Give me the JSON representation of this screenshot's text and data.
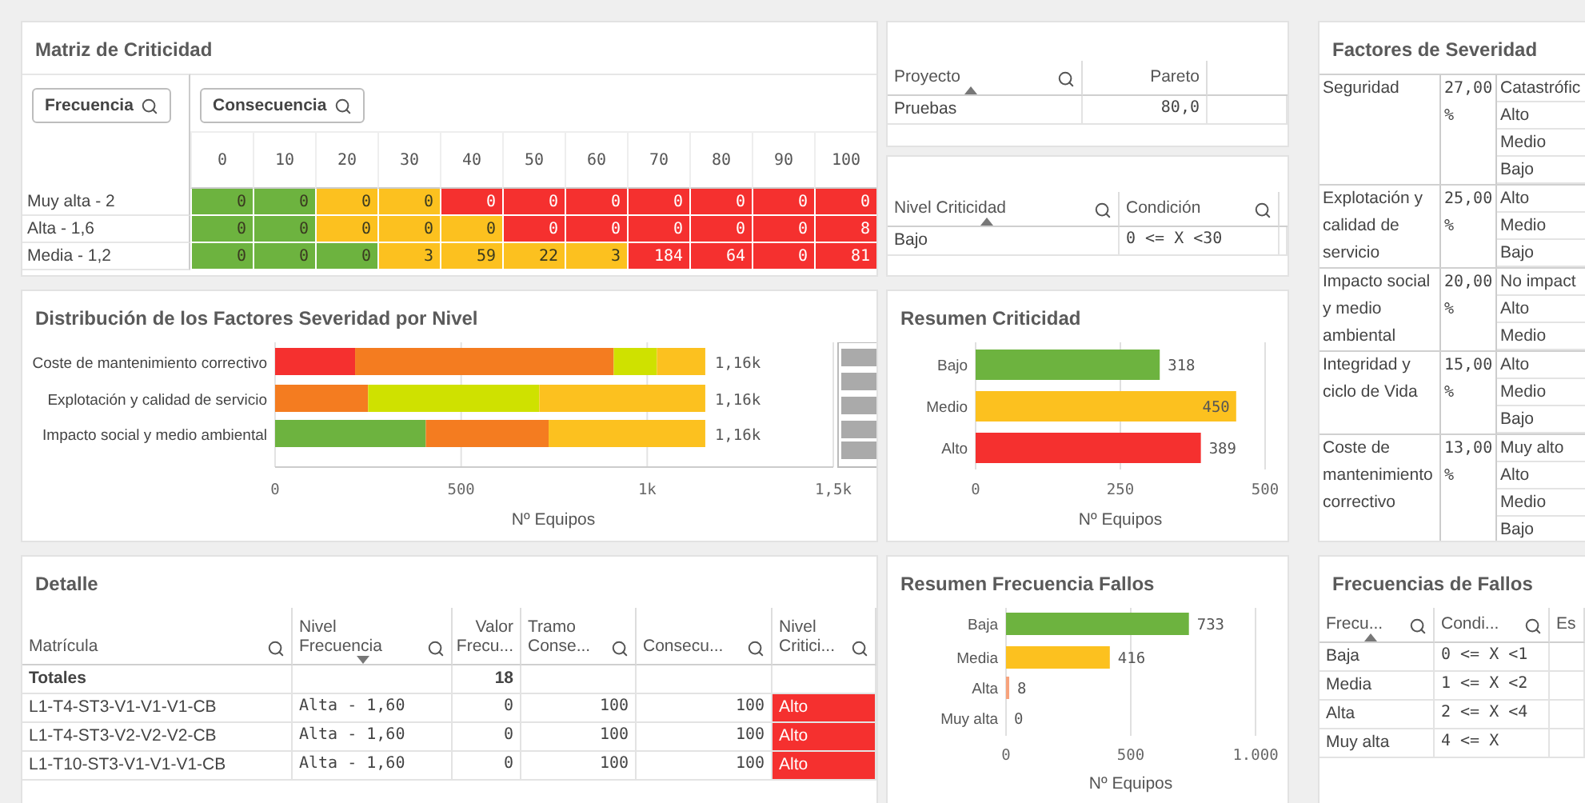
{
  "matrix": {
    "title": "Matriz de Criticidad",
    "row_filter": "Frecuencia",
    "column_filter": "Consecuencia",
    "columns": [
      "0",
      "10",
      "20",
      "30",
      "40",
      "50",
      "60",
      "70",
      "80",
      "90",
      "100"
    ],
    "rows": [
      {
        "label": "Muy alta - 2",
        "cells": [
          {
            "value": "0",
            "color": "#6db33f"
          },
          {
            "value": "0",
            "color": "#6db33f"
          },
          {
            "value": "0",
            "color": "#fcc11f"
          },
          {
            "value": "0",
            "color": "#fcc11f"
          },
          {
            "value": "0",
            "color": "#f5302f"
          },
          {
            "value": "0",
            "color": "#f5302f"
          },
          {
            "value": "0",
            "color": "#f5302f"
          },
          {
            "value": "0",
            "color": "#f5302f"
          },
          {
            "value": "0",
            "color": "#f5302f"
          },
          {
            "value": "0",
            "color": "#f5302f"
          },
          {
            "value": "0",
            "color": "#f5302f"
          }
        ]
      },
      {
        "label": "Alta - 1,6",
        "cells": [
          {
            "value": "0",
            "color": "#6db33f"
          },
          {
            "value": "0",
            "color": "#6db33f"
          },
          {
            "value": "0",
            "color": "#fcc11f"
          },
          {
            "value": "0",
            "color": "#fcc11f"
          },
          {
            "value": "0",
            "color": "#fcc11f"
          },
          {
            "value": "0",
            "color": "#f5302f"
          },
          {
            "value": "0",
            "color": "#f5302f"
          },
          {
            "value": "0",
            "color": "#f5302f"
          },
          {
            "value": "0",
            "color": "#f5302f"
          },
          {
            "value": "0",
            "color": "#f5302f"
          },
          {
            "value": "8",
            "color": "#f5302f"
          }
        ]
      },
      {
        "label": "Media - 1,2",
        "cells": [
          {
            "value": "0",
            "color": "#6db33f"
          },
          {
            "value": "0",
            "color": "#6db33f"
          },
          {
            "value": "0",
            "color": "#6db33f"
          },
          {
            "value": "3",
            "color": "#fcc11f"
          },
          {
            "value": "59",
            "color": "#fcc11f"
          },
          {
            "value": "22",
            "color": "#fcc11f"
          },
          {
            "value": "3",
            "color": "#fcc11f"
          },
          {
            "value": "184",
            "color": "#f5302f"
          },
          {
            "value": "64",
            "color": "#f5302f"
          },
          {
            "value": "0",
            "color": "#f5302f"
          },
          {
            "value": "81",
            "color": "#f5302f"
          }
        ]
      }
    ]
  },
  "project_table": {
    "columns": [
      {
        "label": "Proyecto",
        "search": true,
        "sorted": true,
        "descending": false
      },
      {
        "label": "Pareto",
        "search": false,
        "sorted": false
      }
    ],
    "rows": [
      [
        "Pruebas",
        "80,0"
      ]
    ]
  },
  "criticity_table": {
    "columns": [
      {
        "label": "Nivel Criticidad",
        "search": true,
        "sorted": true,
        "descending": false
      },
      {
        "label": "Condición",
        "search": true,
        "sorted": false
      }
    ],
    "rows": [
      [
        "Bajo",
        "0 <= X <30"
      ]
    ]
  },
  "severity_factors": {
    "title": "Factores de Severidad",
    "groups": [
      {
        "factor": "Seguridad",
        "weight": "27,00 %",
        "levels": [
          "Catastrófic",
          "Alto",
          "Medio",
          "Bajo"
        ]
      },
      {
        "factor": "Explotación y calidad de servicio",
        "weight": "25,00 %",
        "levels": [
          "Alto",
          "Medio",
          "Bajo"
        ]
      },
      {
        "factor": "Impacto social y medio ambiental",
        "weight": "20,00 %",
        "levels": [
          "No impact",
          "Alto",
          "Medio"
        ]
      },
      {
        "factor": "Integridad y ciclo de Vida",
        "weight": "15,00 %",
        "levels": [
          "Alto",
          "Medio",
          "Bajo"
        ]
      },
      {
        "factor": "Coste de mantenimiento correctivo",
        "weight": "13,00 %",
        "levels": [
          "Muy alto",
          "Alto",
          "Medio",
          "Bajo"
        ]
      }
    ]
  },
  "distribution": {
    "title": "Distribución de los Factores Severidad por Nivel",
    "chart_data": {
      "type": "bar",
      "orientation": "horizontal",
      "stacked": true,
      "xlabel": "Nº Equipos",
      "categories": [
        "Coste de mantenimiento correctivo",
        "Explotación y calidad de servicio",
        "Impacto social y medio ambiental"
      ],
      "series": [
        {
          "color": "#f5302f",
          "values": [
            215,
            0,
            0
          ]
        },
        {
          "color": "#6db33f",
          "values": [
            0,
            0,
            405
          ]
        },
        {
          "color": "#f47c20",
          "values": [
            695,
            250,
            330
          ]
        },
        {
          "color": "#cfe100",
          "values": [
            116,
            460,
            0
          ]
        },
        {
          "color": "#fcc11f",
          "values": [
            130,
            446,
            421
          ]
        }
      ],
      "xlim": [
        0,
        1500
      ],
      "xticks": [
        0,
        500,
        {
          "value": 1000,
          "label": "1k"
        },
        {
          "value": 1500,
          "label": "1,5k"
        }
      ],
      "value_labels": [
        "1,16k",
        "1,16k",
        "1,16k"
      ]
    }
  },
  "criticity_summary": {
    "title": "Resumen Criticidad",
    "chart_data": {
      "type": "bar",
      "orientation": "horizontal",
      "xlabel": "Nº Equipos",
      "categories": [
        "Bajo",
        "Medio",
        "Alto"
      ],
      "series": [
        {
          "values": [
            318,
            450,
            389
          ]
        }
      ],
      "colors": [
        "#6db33f",
        "#fcc11f",
        "#f5302f"
      ],
      "xlim": [
        0,
        500
      ],
      "xticks": [
        0,
        250,
        500
      ],
      "data_labels": true
    }
  },
  "frequency_summary": {
    "title": "Resumen Frecuencia Fallos",
    "chart_data": {
      "type": "bar",
      "orientation": "horizontal",
      "xlabel": "Nº Equipos",
      "categories": [
        "Baja",
        "Media",
        "Alta",
        "Muy alta"
      ],
      "series": [
        {
          "values": [
            733,
            416,
            8,
            0
          ]
        }
      ],
      "colors": [
        "#6db33f",
        "#fcc11f",
        "#f7a27c"
      ],
      "xlim": [
        0,
        1000
      ],
      "xticks": [
        0,
        500,
        {
          "value": 1000,
          "label": "1.000"
        }
      ],
      "data_labels": true
    }
  },
  "detail": {
    "title": "Detalle",
    "columns": [
      {
        "label": "Matrícula",
        "search": true,
        "sorted": false
      },
      {
        "label": "Nivel Frecuencia",
        "search": true,
        "sorted": true,
        "descending": true
      },
      {
        "label": "Valor Frecu...",
        "search": false,
        "sorted": false
      },
      {
        "label": "Tramo Conse...",
        "search": true,
        "sorted": false
      },
      {
        "label": "Consecu...",
        "search": true,
        "sorted": false
      },
      {
        "label": "Nivel Critici...",
        "search": true,
        "sorted": false
      }
    ],
    "totals": {
      "label": "Totales",
      "frequency_value": "18"
    },
    "rows": [
      {
        "cells": [
          "L1-T4-ST3-V1-V1-V1-CB",
          "Alta - 1,60",
          "0",
          "100",
          "100",
          "Alto"
        ],
        "color": "#f5302f"
      },
      {
        "cells": [
          "L1-T4-ST3-V2-V2-V2-CB",
          "Alta - 1,60",
          "0",
          "100",
          "100",
          "Alto"
        ],
        "color": "#f5302f"
      },
      {
        "cells": [
          "L1-T10-ST3-V1-V1-V1-CB",
          "Alta - 1,60",
          "0",
          "100",
          "100",
          "Alto"
        ],
        "color": "#f5302f"
      }
    ]
  },
  "failure_frequencies": {
    "title": "Frecuencias de Fallos",
    "columns": [
      {
        "label": "Frecu...",
        "search": true,
        "sorted": true,
        "descending": false
      },
      {
        "label": "Condi...",
        "search": true,
        "sorted": false
      },
      {
        "label": "Es",
        "search": false,
        "sorted": false
      }
    ],
    "rows": [
      [
        "Baja",
        "0 <= X <1"
      ],
      [
        "Media",
        "1 <= X <2"
      ],
      [
        "Alta",
        "2 <= X <4"
      ],
      [
        "Muy alta",
        "4 <= X"
      ]
    ]
  }
}
